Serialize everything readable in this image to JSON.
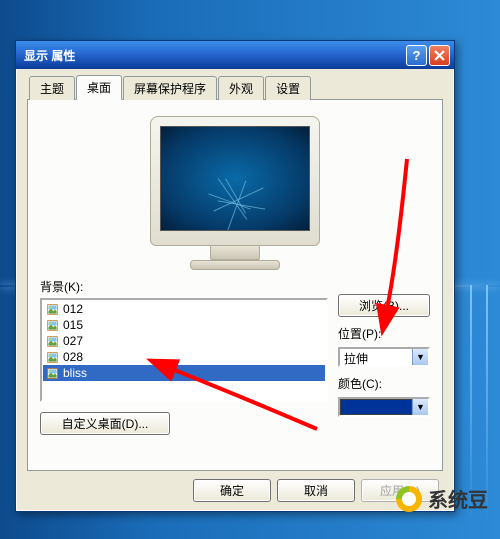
{
  "dialog": {
    "title": "显示 属性"
  },
  "tabs": {
    "theme": "主题",
    "desktop": "桌面",
    "screensaver": "屏幕保护程序",
    "appearance": "外观",
    "settings": "设置"
  },
  "desktop": {
    "background_label": "背景(K):",
    "items": [
      {
        "name": "012",
        "type": "image"
      },
      {
        "name": "015",
        "type": "image"
      },
      {
        "name": "027",
        "type": "image"
      },
      {
        "name": "028",
        "type": "image"
      },
      {
        "name": "bliss",
        "type": "image",
        "selected": true
      }
    ],
    "browse_btn": "浏览(B)...",
    "position_label": "位置(P):",
    "position_value": "拉伸",
    "color_label": "颜色(C):",
    "color_value": "#003399",
    "custom_btn": "自定义桌面(D)..."
  },
  "buttons": {
    "ok": "确定",
    "cancel": "取消",
    "apply": "应用(A)"
  },
  "watermark": "系统豆"
}
